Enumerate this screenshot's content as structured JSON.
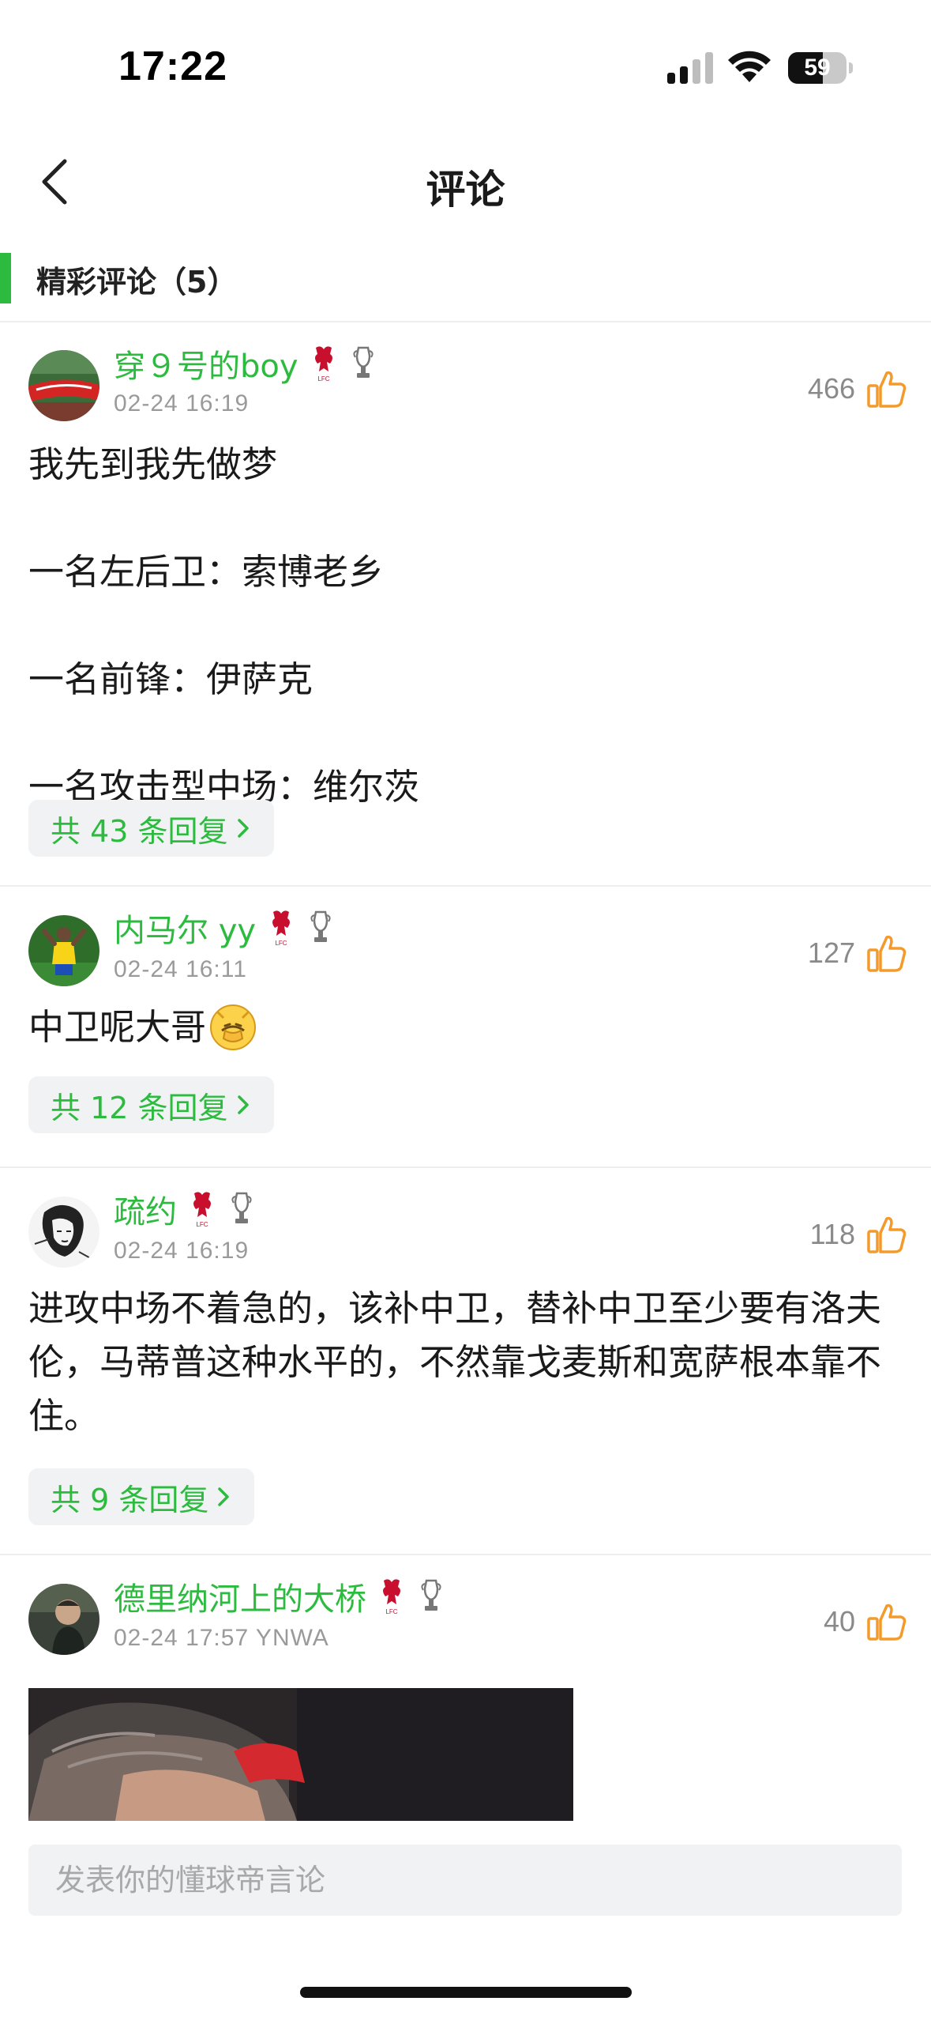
{
  "status_bar": {
    "time": "17:22",
    "battery": "59",
    "battery_level": 0.59,
    "signal_icon": "cellular-signal-icon",
    "wifi_icon": "wifi-icon"
  },
  "nav": {
    "back_icon": "chevron-left-icon",
    "title": "评论"
  },
  "section": {
    "title": "精彩评论（5）",
    "accent_color": "#2dbb3f"
  },
  "comments": [
    {
      "username": "穿９号的boy",
      "timestamp": "02-24 16:19",
      "likes": "466",
      "text": "我先到我先做梦\n\n一名左后卫：索博老乡\n\n一名前锋：伊萨克\n\n一名攻击型中场：维尔茨",
      "reply_label": "共 43 条回复"
    },
    {
      "username": "内马尔 yy",
      "timestamp": "02-24 16:11",
      "likes": "127",
      "text": "中卫呢大哥",
      "emoji": "facepalm-emoji-icon",
      "reply_label": "共 12 条回复"
    },
    {
      "username": "疏约",
      "timestamp": "02-24 16:19",
      "likes": "118",
      "text": "进攻中场不着急的，该补中卫，替补中卫至少要有洛夫伦，马蒂普这种水平的，不然靠戈麦斯和宽萨根本靠不住。",
      "reply_label": "共 9 条回复"
    },
    {
      "username": "德里纳河上的大桥",
      "timestamp": "02-24 17:57 YNWA",
      "likes": "40",
      "image": "comment-photo"
    }
  ],
  "input": {
    "placeholder": "发表你的懂球帝言论"
  },
  "colors": {
    "username": "#2dbb3f",
    "like_icon": "#f39a2b",
    "reply_bg": "#f1f2f3"
  }
}
